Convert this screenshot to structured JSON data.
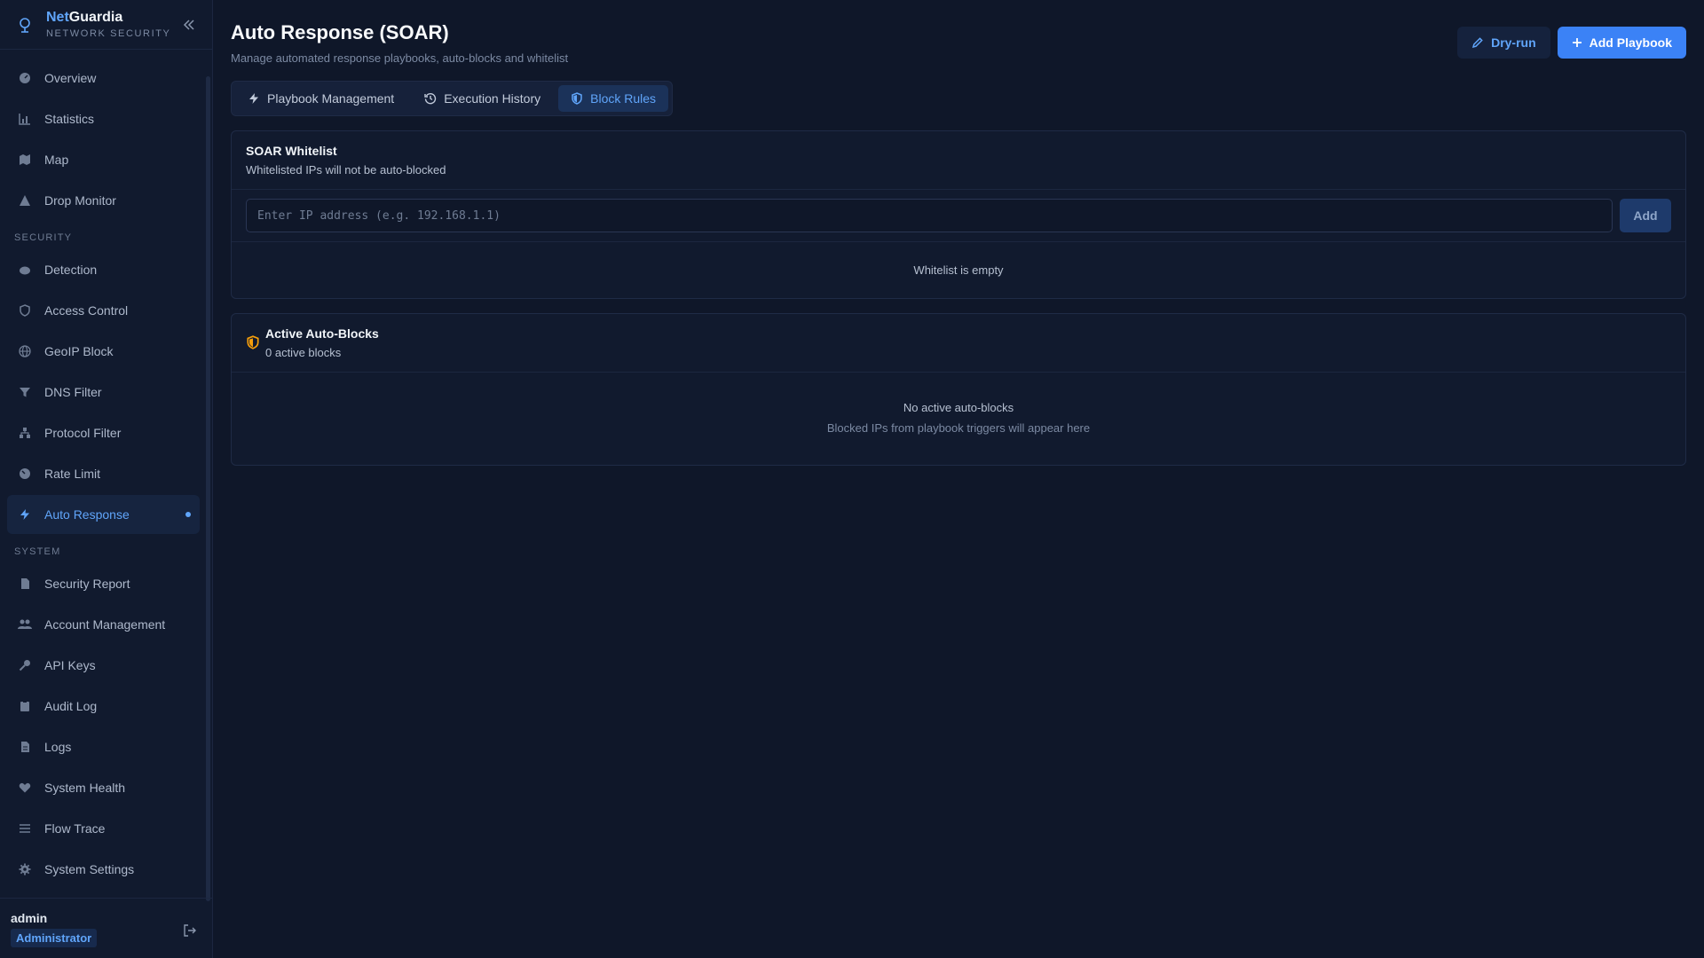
{
  "brand": {
    "name_prefix": "Net",
    "name_suffix": "Guardia",
    "subtitle": "NETWORK SECURITY"
  },
  "nav": {
    "main_items": [
      {
        "label": "Overview",
        "icon": "gauge-icon"
      },
      {
        "label": "Statistics",
        "icon": "bar-chart-icon"
      },
      {
        "label": "Map",
        "icon": "map-icon"
      },
      {
        "label": "Drop Monitor",
        "icon": "warning-icon"
      }
    ],
    "security_section": "SECURITY",
    "security_items": [
      {
        "label": "Detection",
        "icon": "radar-icon"
      },
      {
        "label": "Access Control",
        "icon": "shield-icon"
      },
      {
        "label": "GeoIP Block",
        "icon": "globe-icon"
      },
      {
        "label": "DNS Filter",
        "icon": "filter-icon"
      },
      {
        "label": "Protocol Filter",
        "icon": "network-icon"
      },
      {
        "label": "Rate Limit",
        "icon": "gauge-icon"
      },
      {
        "label": "Auto Response",
        "icon": "bolt-icon",
        "active": true
      }
    ],
    "system_section": "SYSTEM",
    "system_items": [
      {
        "label": "Security Report",
        "icon": "document-icon"
      },
      {
        "label": "Account Management",
        "icon": "users-icon"
      },
      {
        "label": "API Keys",
        "icon": "key-icon"
      },
      {
        "label": "Audit Log",
        "icon": "clipboard-icon"
      },
      {
        "label": "Logs",
        "icon": "file-icon"
      },
      {
        "label": "System Health",
        "icon": "heart-pulse-icon"
      },
      {
        "label": "Flow Trace",
        "icon": "list-icon"
      },
      {
        "label": "System Settings",
        "icon": "gear-icon"
      }
    ]
  },
  "user": {
    "name": "admin",
    "role": "Administrator"
  },
  "header": {
    "title": "Auto Response (SOAR)",
    "subtitle": "Manage automated response playbooks, auto-blocks and whitelist",
    "dry_run_label": "Dry-run",
    "add_playbook_label": "Add Playbook"
  },
  "tabs": [
    {
      "label": "Playbook Management"
    },
    {
      "label": "Execution History"
    },
    {
      "label": "Block Rules",
      "active": true
    }
  ],
  "whitelist": {
    "title": "SOAR Whitelist",
    "description": "Whitelisted IPs will not be auto-blocked",
    "input_placeholder": "Enter IP address (e.g. 192.168.1.1)",
    "add_label": "Add",
    "empty_text": "Whitelist is empty"
  },
  "auto_blocks": {
    "title": "Active Auto-Blocks",
    "count_text": "0 active blocks",
    "empty_title": "No active auto-blocks",
    "empty_hint": "Blocked IPs from playbook triggers will appear here"
  },
  "colors": {
    "accent": "#3b82f6",
    "warning": "#f59e0b",
    "background": "#0f1729"
  }
}
